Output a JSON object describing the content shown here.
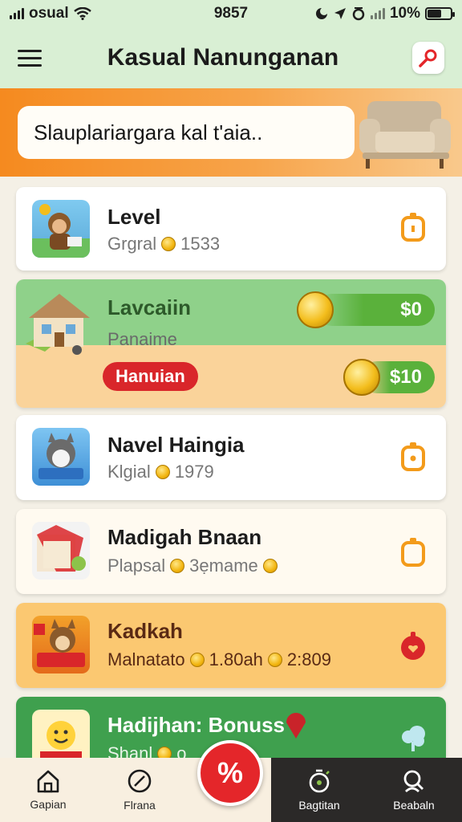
{
  "status": {
    "carrier": "osual",
    "time": "9857",
    "battery": "10%"
  },
  "header": {
    "title": "Kasual Nanunganan"
  },
  "banner": {
    "text": "Slauplariargara kal t'aia.."
  },
  "items": [
    {
      "title": "Level",
      "sub_prefix": "Grgral",
      "sub_value": "1533"
    },
    {
      "title": "Navel Haingia",
      "sub_prefix": "Klgial",
      "sub_value": "1979"
    },
    {
      "title": "Madigah Bnaan",
      "sub_prefix": "Plapsal",
      "sub_value": "3ẹmame"
    },
    {
      "title": "Kadkah",
      "sub_prefix": "Malnatato",
      "sub_value": "1.80ah",
      "sub_value2": "2:809"
    },
    {
      "title": "Hadijhan: Bonuss",
      "sub_prefix": "Shanl",
      "sub_value": "o"
    }
  ],
  "featured": {
    "title": "Lavcaiin",
    "subtitle": "Panaime",
    "tag": "Hanuian",
    "price_top": "$0",
    "price_bottom": "$10"
  },
  "nav": {
    "home": "Gapian",
    "arena": "Flrana",
    "center": "%",
    "bagian": "Bagtitan",
    "search": "Beabaln"
  },
  "colors": {
    "header_bg": "#d9efd4",
    "banner_orange": "#f58a1f",
    "accent_red": "#e4262a",
    "accent_green": "#5ab13b",
    "icon_orange": "#f39b1b"
  }
}
